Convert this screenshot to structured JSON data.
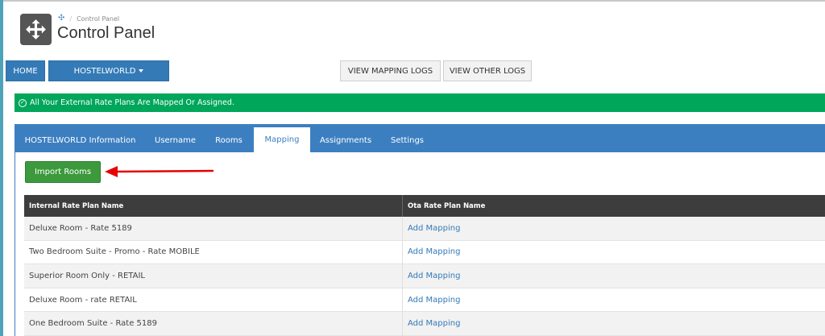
{
  "breadcrumb": {
    "current": "Control Panel"
  },
  "page": {
    "title": "Control Panel"
  },
  "nav": {
    "home": "HOME",
    "channel": "HOSTELWORLD",
    "view_mapping_logs": "VIEW MAPPING LOGS",
    "view_other_logs": "VIEW OTHER LOGS"
  },
  "alert": {
    "text": "All Your External Rate Plans Are Mapped Or Assigned."
  },
  "tabs": [
    {
      "label": "HOSTELWORLD Information",
      "active": false
    },
    {
      "label": "Username",
      "active": false
    },
    {
      "label": "Rooms",
      "active": false
    },
    {
      "label": "Mapping",
      "active": true
    },
    {
      "label": "Assignments",
      "active": false
    },
    {
      "label": "Settings",
      "active": false
    }
  ],
  "import_button": "Import Rooms",
  "table": {
    "headers": [
      "Internal Rate Plan Name",
      "Ota Rate Plan Name"
    ],
    "rows": [
      {
        "internal": "Deluxe Room - Rate 5189",
        "ota": "Add Mapping"
      },
      {
        "internal": "Two Bedroom Suite - Promo - Rate MOBILE",
        "ota": "Add Mapping"
      },
      {
        "internal": "Superior Room Only - RETAIL",
        "ota": "Add Mapping"
      },
      {
        "internal": "Deluxe Room - rate RETAIL",
        "ota": "Add Mapping"
      },
      {
        "internal": "One Bedroom Suite - Rate 5189",
        "ota": "Add Mapping"
      }
    ]
  },
  "colors": {
    "primary": "#337ab7",
    "tab_bar": "#3c7fc0",
    "success": "#00a65a",
    "import_button": "#3c9a3c",
    "table_header": "#3d3d3d",
    "annotation_arrow": "#e60000"
  },
  "icons": {
    "app": "move-arrows-icon",
    "breadcrumb": "move-arrows-icon",
    "alert": "check-circle-icon",
    "dropdown": "caret-down-icon"
  }
}
